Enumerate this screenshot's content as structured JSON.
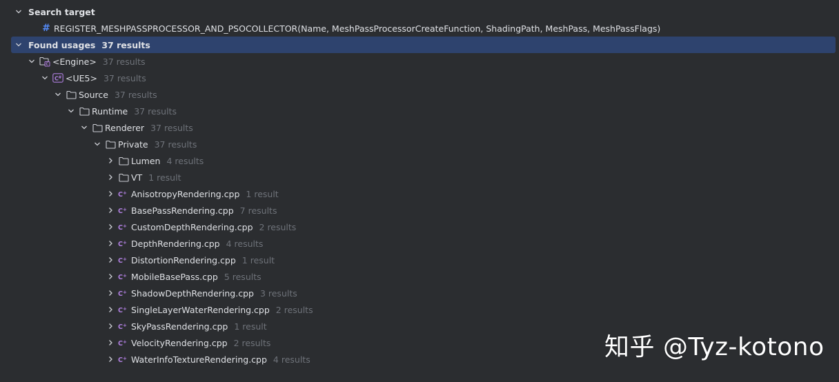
{
  "search_target": {
    "header": "Search target",
    "item": "REGISTER_MESHPASSPROCESSOR_AND_PSOCOLLECTOR(Name, MeshPassProcessorCreateFunction, ShadingPath, MeshPass, MeshPassFlags)"
  },
  "found_usages": {
    "header": "Found usages",
    "count": "37 results"
  },
  "tree": [
    {
      "label": "<Engine>",
      "count": "37 results",
      "icon": "module-icon",
      "chev": "down",
      "level": 1
    },
    {
      "label": "<UE5>",
      "count": "37 results",
      "icon": "csharp-project-icon",
      "chev": "down",
      "level": 2
    },
    {
      "label": "Source",
      "count": "37 results",
      "icon": "folder-icon",
      "chev": "down",
      "level": 3
    },
    {
      "label": "Runtime",
      "count": "37 results",
      "icon": "folder-icon",
      "chev": "down",
      "level": 4
    },
    {
      "label": "Renderer",
      "count": "37 results",
      "icon": "folder-icon",
      "chev": "down",
      "level": 5
    },
    {
      "label": "Private",
      "count": "37 results",
      "icon": "folder-icon",
      "chev": "down",
      "level": 6
    },
    {
      "label": "Lumen",
      "count": "4 results",
      "icon": "folder-icon",
      "chev": "right",
      "level": 7
    },
    {
      "label": "VT",
      "count": "1 result",
      "icon": "folder-icon",
      "chev": "right",
      "level": 7
    },
    {
      "label": "AnisotropyRendering.cpp",
      "count": "1 result",
      "icon": "cpp-file-icon",
      "chev": "right",
      "level": 7
    },
    {
      "label": "BasePassRendering.cpp",
      "count": "7 results",
      "icon": "cpp-file-icon",
      "chev": "right",
      "level": 7
    },
    {
      "label": "CustomDepthRendering.cpp",
      "count": "2 results",
      "icon": "cpp-file-icon",
      "chev": "right",
      "level": 7
    },
    {
      "label": "DepthRendering.cpp",
      "count": "4 results",
      "icon": "cpp-file-icon",
      "chev": "right",
      "level": 7
    },
    {
      "label": "DistortionRendering.cpp",
      "count": "1 result",
      "icon": "cpp-file-icon",
      "chev": "right",
      "level": 7
    },
    {
      "label": "MobileBasePass.cpp",
      "count": "5 results",
      "icon": "cpp-file-icon",
      "chev": "right",
      "level": 7
    },
    {
      "label": "ShadowDepthRendering.cpp",
      "count": "3 results",
      "icon": "cpp-file-icon",
      "chev": "right",
      "level": 7
    },
    {
      "label": "SingleLayerWaterRendering.cpp",
      "count": "2 results",
      "icon": "cpp-file-icon",
      "chev": "right",
      "level": 7
    },
    {
      "label": "SkyPassRendering.cpp",
      "count": "1 result",
      "icon": "cpp-file-icon",
      "chev": "right",
      "level": 7
    },
    {
      "label": "VelocityRendering.cpp",
      "count": "2 results",
      "icon": "cpp-file-icon",
      "chev": "right",
      "level": 7
    },
    {
      "label": "WaterInfoTextureRendering.cpp",
      "count": "4 results",
      "icon": "cpp-file-icon",
      "chev": "right",
      "level": 7
    }
  ],
  "watermark": "知乎 @Tyz-kotono",
  "colors": {
    "background": "#2b2d30",
    "selection": "#2e436e",
    "accent_blue": "#548af7",
    "cpp_purple": "#b07fe0",
    "muted_text": "#6f737a",
    "text": "#dfe1e5"
  }
}
